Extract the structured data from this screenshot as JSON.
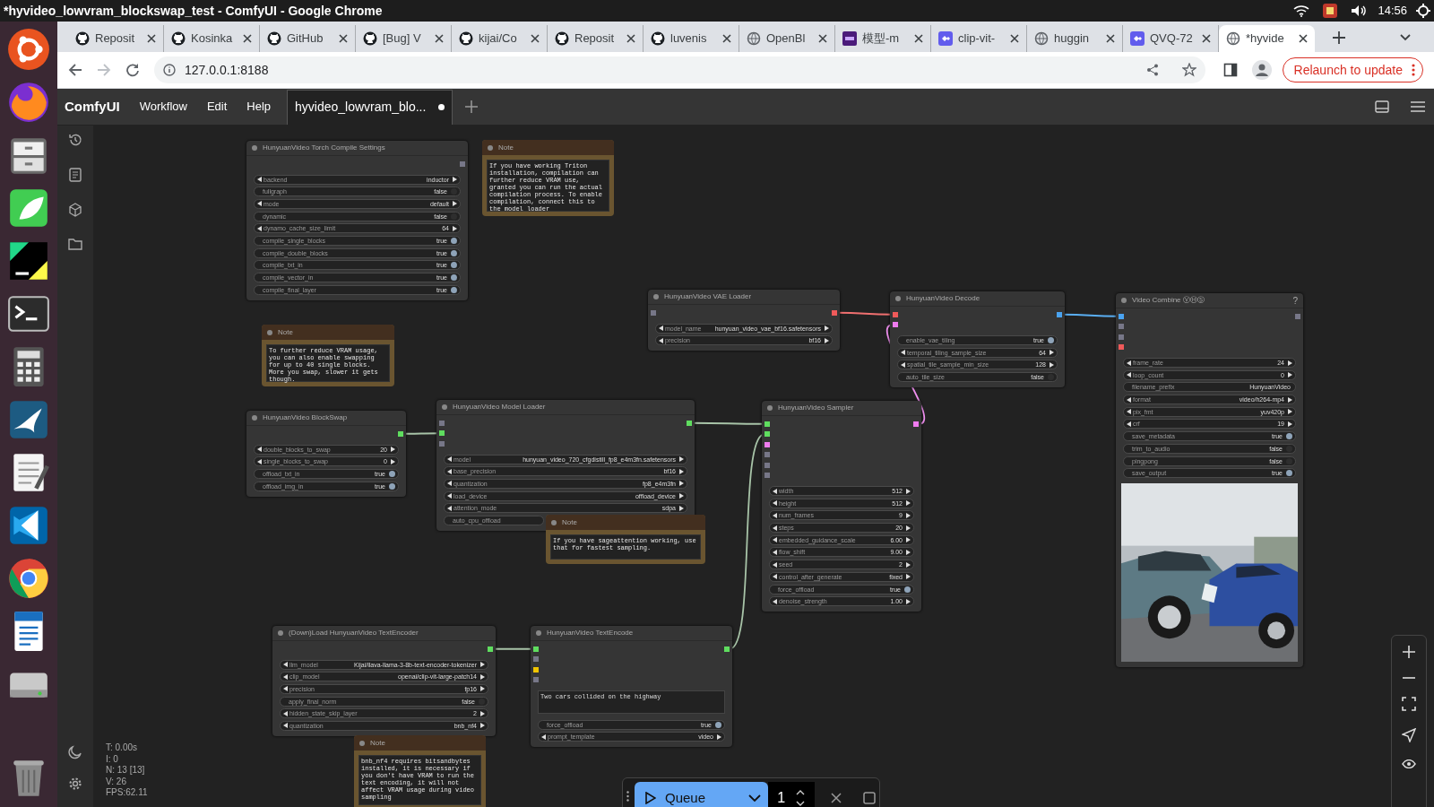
{
  "os_bar": {
    "title": "*hyvideo_lowvram_blockswap_test - ComfyUI - Google Chrome",
    "time": "14:56"
  },
  "browser": {
    "tabs": [
      {
        "label": "Reposit",
        "kind": "octocat",
        "selected": false
      },
      {
        "label": "Kosinka",
        "kind": "octocat",
        "selected": false
      },
      {
        "label": "GitHub",
        "kind": "octocat",
        "selected": false
      },
      {
        "label": "[Bug] V",
        "kind": "octocat",
        "selected": false
      },
      {
        "label": "kijai/Co",
        "kind": "octocat",
        "selected": false
      },
      {
        "label": "Reposit",
        "kind": "octocat",
        "selected": false
      },
      {
        "label": "luvenis",
        "kind": "octocat",
        "selected": false
      },
      {
        "label": "OpenBl",
        "kind": "globe",
        "selected": false
      },
      {
        "label": "模型-m",
        "kind": "purple-square",
        "selected": false
      },
      {
        "label": "clip-vit-",
        "kind": "blue-square",
        "selected": false
      },
      {
        "label": "huggin",
        "kind": "globe",
        "selected": false
      },
      {
        "label": "QVQ-72",
        "kind": "blue-square",
        "selected": false
      },
      {
        "label": "*hyvide",
        "kind": "globe",
        "selected": true
      }
    ],
    "address": "127.0.0.1:8188",
    "relaunch": "Relaunch to update"
  },
  "app": {
    "brand": "ComfyUI",
    "menu": [
      "Workflow",
      "Edit",
      "Help"
    ],
    "workflow_tabs": [
      {
        "label": "hyvideo_lowvram_blo...",
        "selected": true,
        "modified": true
      }
    ]
  },
  "nodes": [
    {
      "kind": "node",
      "title": "HunyuanVideo Torch Compile Settings",
      "widgets": [
        {
          "kind": "combo",
          "label": "backend",
          "value": "inductor"
        },
        {
          "kind": "toggle",
          "label": "fullgraph",
          "value": "false",
          "on": false
        },
        {
          "kind": "combo",
          "label": "mode",
          "value": "default"
        },
        {
          "kind": "toggle",
          "label": "dynamic",
          "value": "false",
          "on": false
        },
        {
          "kind": "number",
          "label": "dynamo_cache_size_limit",
          "value": "64"
        },
        {
          "kind": "toggle",
          "label": "compile_single_blocks",
          "value": "true",
          "on": true
        },
        {
          "kind": "toggle",
          "label": "compile_double_blocks",
          "value": "true",
          "on": true
        },
        {
          "kind": "toggle",
          "label": "compile_txt_in",
          "value": "true",
          "on": true
        },
        {
          "kind": "toggle",
          "label": "compile_vector_in",
          "value": "true",
          "on": true
        },
        {
          "kind": "toggle",
          "label": "compile_final_layer",
          "value": "true",
          "on": true
        }
      ]
    },
    {
      "kind": "note",
      "title": "Note",
      "text": "If you have working Triton installation, compilation can further reduce VRAM use, granted you can run the actual compilation process. To enable compilation, connect this to the model loader"
    },
    {
      "kind": "note",
      "title": "Note",
      "text": "To further reduce VRAM usage, you can also enable swapping for up to 40 single blocks. More you swap, slower it gets though."
    },
    {
      "kind": "node",
      "title": "HunyuanVideo VAE Loader",
      "widgets": [
        {
          "kind": "combo",
          "label": "model_name",
          "value": "hunyuan_video_vae_bf16.safetensors"
        },
        {
          "kind": "combo",
          "label": "precision",
          "value": "bf16"
        }
      ]
    },
    {
      "kind": "node",
      "title": "HunyuanVideo Decode",
      "widgets": [
        {
          "kind": "toggle",
          "label": "enable_vae_tiling",
          "value": "true",
          "on": true
        },
        {
          "kind": "number",
          "label": "temporal_tiling_sample_size",
          "value": "64"
        },
        {
          "kind": "number",
          "label": "spatial_tile_sample_min_size",
          "value": "128"
        },
        {
          "kind": "toggle",
          "label": "auto_tile_size",
          "value": "false",
          "on": false
        }
      ]
    },
    {
      "kind": "node",
      "title": "Video Combine ⓋⒽⓈ",
      "help": "?",
      "widgets": [
        {
          "kind": "number",
          "label": "frame_rate",
          "value": "24"
        },
        {
          "kind": "number",
          "label": "loop_count",
          "value": "0"
        },
        {
          "kind": "text",
          "label": "filename_prefix",
          "value": "HunyuanVideo"
        },
        {
          "kind": "combo",
          "label": "format",
          "value": "video/h264-mp4"
        },
        {
          "kind": "combo",
          "label": "pix_fmt",
          "value": "yuv420p"
        },
        {
          "kind": "number",
          "label": "crf",
          "value": "19"
        },
        {
          "kind": "toggle",
          "label": "save_metadata",
          "value": "true",
          "on": true
        },
        {
          "kind": "toggle",
          "label": "trim_to_audio",
          "value": "false",
          "on": false
        },
        {
          "kind": "toggle",
          "label": "pingpong",
          "value": "false",
          "on": false
        },
        {
          "kind": "toggle",
          "label": "save_output",
          "value": "true",
          "on": true
        }
      ]
    },
    {
      "kind": "node",
      "title": "HunyuanVideo Model Loader",
      "widgets": [
        {
          "kind": "combo",
          "label": "model",
          "value": "hunyuan_video_720_cfgdistill_fp8_e4m3fn.safetensors"
        },
        {
          "kind": "combo",
          "label": "base_precision",
          "value": "bf16"
        },
        {
          "kind": "combo",
          "label": "quantization",
          "value": "fp8_e4m3fn"
        },
        {
          "kind": "combo",
          "label": "load_device",
          "value": "offload_device"
        },
        {
          "kind": "combo",
          "label": "attention_mode",
          "value": "sdpa"
        },
        {
          "kind": "toggle",
          "label": "auto_cpu_offload"
        }
      ]
    },
    {
      "kind": "node",
      "title": "HunyuanVideo Sampler",
      "widgets": [
        {
          "kind": "number",
          "label": "width",
          "value": "512"
        },
        {
          "kind": "number",
          "label": "height",
          "value": "512"
        },
        {
          "kind": "number",
          "label": "num_frames",
          "value": "9"
        },
        {
          "kind": "number",
          "label": "steps",
          "value": "20"
        },
        {
          "kind": "number",
          "label": "embedded_guidance_scale",
          "value": "6.00"
        },
        {
          "kind": "number",
          "label": "flow_shift",
          "value": "9.00"
        },
        {
          "kind": "number",
          "label": "seed",
          "value": "2"
        },
        {
          "kind": "combo",
          "label": "control_after_generate",
          "value": "fixed"
        },
        {
          "kind": "toggle",
          "label": "force_offload",
          "value": "true",
          "on": true
        },
        {
          "kind": "number",
          "label": "denoise_strength",
          "value": "1.00"
        }
      ]
    },
    {
      "kind": "node",
      "title": "HunyuanVideo BlockSwap",
      "widgets": [
        {
          "kind": "number",
          "label": "double_blocks_to_swap",
          "value": "20"
        },
        {
          "kind": "number",
          "label": "single_blocks_to_swap",
          "value": "0"
        },
        {
          "kind": "toggle",
          "label": "offload_txt_in",
          "value": "true",
          "on": true
        },
        {
          "kind": "toggle",
          "label": "offload_img_in",
          "value": "true",
          "on": true
        }
      ]
    },
    {
      "kind": "note",
      "title": "Note",
      "text": "If you have sageattention working, use that for fastest sampling."
    },
    {
      "kind": "node",
      "title": "(Down)Load HunyuanVideo TextEncoder",
      "widgets": [
        {
          "kind": "combo",
          "label": "llm_model",
          "value": "Kijai/llava-llama-3-8b-text-encoder-tokenizer"
        },
        {
          "kind": "combo",
          "label": "clip_model",
          "value": "openai/clip-vit-large-patch14"
        },
        {
          "kind": "combo",
          "label": "precision",
          "value": "fp16"
        },
        {
          "kind": "toggle",
          "label": "apply_final_norm",
          "value": "false",
          "on": false
        },
        {
          "kind": "number",
          "label": "hidden_state_skip_layer",
          "value": "2"
        },
        {
          "kind": "combo",
          "label": "quantization",
          "value": "bnb_nf4"
        }
      ]
    },
    {
      "kind": "node",
      "title": "HunyuanVideo TextEncode",
      "widgets": [
        {
          "kind": "textarea",
          "value": "Two cars collided on the highway"
        },
        {
          "kind": "toggle",
          "label": "force_offload",
          "value": "true",
          "on": true
        },
        {
          "kind": "combo",
          "label": "prompt_template",
          "value": "video"
        }
      ]
    },
    {
      "kind": "note",
      "title": "Note",
      "text": "bnb_nf4 requires bitsandbytes installed, it is necessary if you don't have VRAM to run the text encoding, it will not affect VRAM usage during video sampling"
    }
  ],
  "stats": [
    "T: 0.00s",
    "I: 0",
    "N: 13 [13]",
    "V: 26",
    "FPS:62.11"
  ],
  "queue": {
    "label": "Queue",
    "count": "1"
  }
}
